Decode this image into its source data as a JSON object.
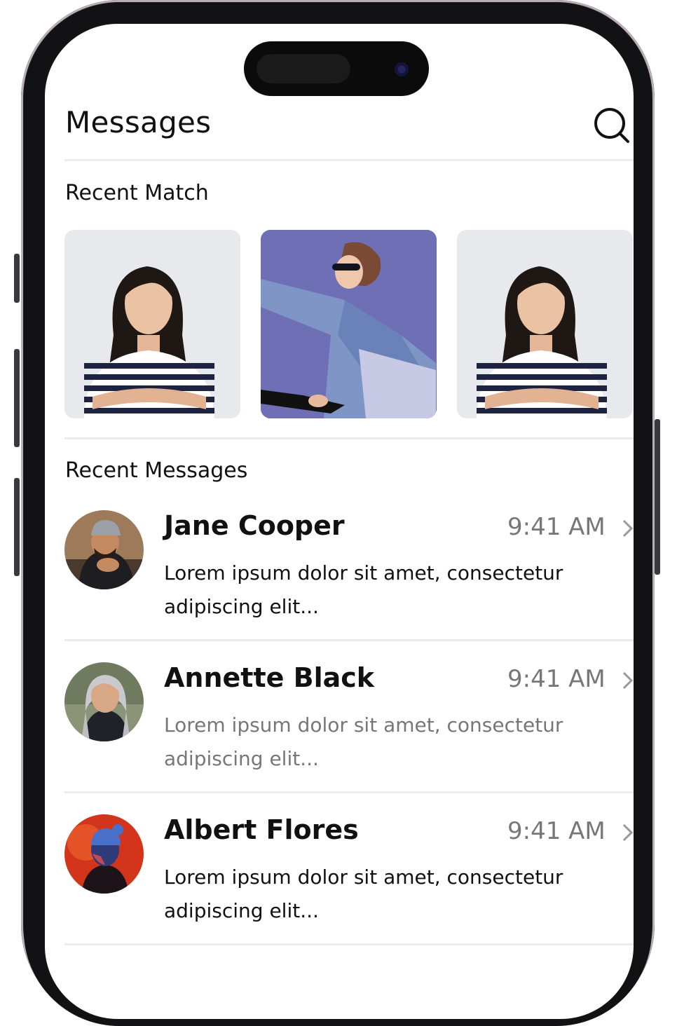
{
  "header": {
    "title": "Messages",
    "search_icon": "search-icon"
  },
  "recent_match": {
    "title": "Recent Match",
    "cards": [
      {
        "photo": "woman-striped-shirt-photo",
        "bg": "#e7e9ec"
      },
      {
        "photo": "woman-denim-jacket-bicycle-photo",
        "bg": "#6f6fb5"
      },
      {
        "photo": "woman-striped-shirt-photo",
        "bg": "#e7e9ec"
      }
    ]
  },
  "recent_messages": {
    "title": "Recent Messages",
    "items": [
      {
        "name": "Jane Cooper",
        "time": "9:41 AM",
        "preview": "Lorem ipsum dolor sit amet, consectetur adipiscing elit...",
        "unread": true
      },
      {
        "name": "Annette Black",
        "time": "9:41 AM",
        "preview": "Lorem ipsum dolor sit amet, consectetur adipiscing elit...",
        "unread": false
      },
      {
        "name": "Albert Flores",
        "time": "9:41 AM",
        "preview": "Lorem ipsum dolor sit amet, consectetur adipiscing elit...",
        "unread": true
      }
    ]
  },
  "colors": {
    "frame": "#121214",
    "text_primary": "#111111",
    "text_secondary": "#777777",
    "divider": "#ececec",
    "match_purple": "#6f6fb5"
  }
}
